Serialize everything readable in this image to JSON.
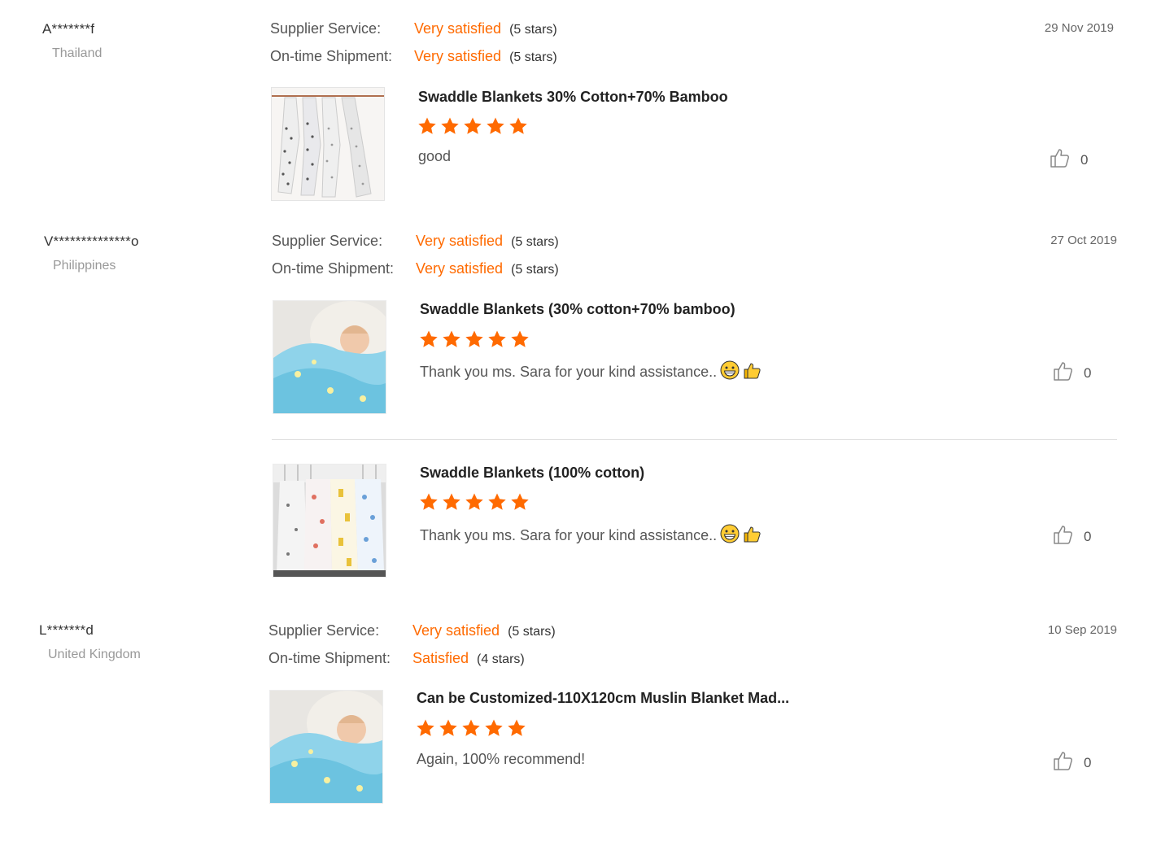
{
  "reviews": [
    {
      "reviewer": "A*******f",
      "country": "Thailand",
      "date": "29 Nov 2019",
      "supplier_label": "Supplier Service:",
      "supplier_value": "Very satisfied",
      "supplier_stars": "(5 stars)",
      "shipment_label": "On-time Shipment:",
      "shipment_value": "Very satisfied",
      "shipment_stars": "(5 stars)",
      "items": [
        {
          "title": "Swaddle Blankets 30% Cotton+70% Bamboo",
          "rating": 5,
          "comment": "good",
          "likes": "0"
        }
      ]
    },
    {
      "reviewer": "V**************o",
      "country": "Philippines",
      "date": "27 Oct 2019",
      "supplier_label": "Supplier Service:",
      "supplier_value": "Very satisfied",
      "supplier_stars": "(5 stars)",
      "shipment_label": "On-time Shipment:",
      "shipment_value": "Very satisfied",
      "shipment_stars": "(5 stars)",
      "items": [
        {
          "title": "Swaddle Blankets (30% cotton+70% bamboo)",
          "rating": 5,
          "comment": "Thank you ms. Sara for your kind assistance..",
          "likes": "0"
        },
        {
          "title": "Swaddle Blankets (100% cotton)",
          "rating": 5,
          "comment": "Thank you ms. Sara for your kind assistance..",
          "likes": "0"
        }
      ]
    },
    {
      "reviewer": "L*******d",
      "country": "United Kingdom",
      "date": "10 Sep 2019",
      "supplier_label": "Supplier Service:",
      "supplier_value": "Very satisfied",
      "supplier_stars": "(5 stars)",
      "shipment_label": "On-time Shipment:",
      "shipment_value": "Satisfied",
      "shipment_stars": "(4 stars)",
      "items": [
        {
          "title": "Can be Customized-110X120cm Muslin Blanket Mad...",
          "rating": 5,
          "comment": "Again, 100% recommend!",
          "likes": "0"
        }
      ]
    }
  ],
  "icons": {
    "like": "thumbs-up-outline-icon",
    "star": "star-icon",
    "emoji_grin": "grinning-emoji-icon",
    "emoji_thumb": "thumbs-up-emoji-icon"
  },
  "colors": {
    "accent": "#ff6a00",
    "muted": "#999999",
    "divider": "#dddddd"
  }
}
